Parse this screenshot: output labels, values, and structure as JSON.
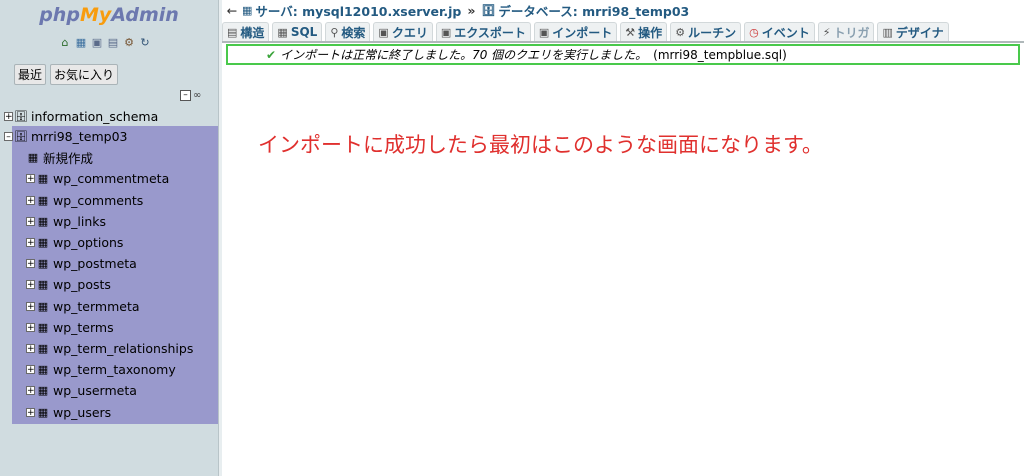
{
  "sidebar": {
    "logo_php": "php",
    "logo_my": "My",
    "logo_admin": "Admin",
    "toolbar_icons": [
      "home-icon",
      "sql-window-icon",
      "query-window-icon",
      "docs-icon",
      "settings-icon",
      "reload-icon"
    ],
    "recent_label": "最近",
    "favorites_label": "お気に入り",
    "collapse_symbol": "–",
    "link_symbol": "∞",
    "info_db": "information_schema",
    "current_db": "mrri98_temp03",
    "new_label": "新規作成",
    "tables": [
      "wp_commentmeta",
      "wp_comments",
      "wp_links",
      "wp_options",
      "wp_postmeta",
      "wp_posts",
      "wp_termmeta",
      "wp_terms",
      "wp_term_relationships",
      "wp_term_taxonomy",
      "wp_usermeta",
      "wp_users"
    ]
  },
  "breadcrumb": {
    "back_arrow": "←",
    "server_label": "サーバ: ",
    "server_value": "mysql12010.xserver.jp",
    "separator": "»",
    "db_label": "データベース: ",
    "db_value": "mrri98_temp03"
  },
  "tabs": [
    {
      "label": "構造",
      "icon": "structure-icon"
    },
    {
      "label": "SQL",
      "icon": "sql-icon"
    },
    {
      "label": "検索",
      "icon": "search-icon"
    },
    {
      "label": "クエリ",
      "icon": "query-icon"
    },
    {
      "label": "エクスポート",
      "icon": "export-icon"
    },
    {
      "label": "インポート",
      "icon": "import-icon"
    },
    {
      "label": "操作",
      "icon": "operations-icon"
    },
    {
      "label": "ルーチン",
      "icon": "routines-icon"
    },
    {
      "label": "イベント",
      "icon": "events-icon"
    },
    {
      "label": "トリガ",
      "icon": "triggers-icon"
    },
    {
      "label": "デザイナ",
      "icon": "designer-icon"
    }
  ],
  "success": {
    "message": "インポートは正常に終了しました。70 個のクエリを実行しました。",
    "file": "(mrri98_tempblue.sql)"
  },
  "annotation": "インポートに成功したら最初はこのような画面になります。",
  "colors": {
    "sidebar_bg": "#d0dce0",
    "db_highlight": "#9999cc",
    "success_border": "#49c94b",
    "annotation_red": "#e0302e",
    "link_blue": "#235a81"
  }
}
